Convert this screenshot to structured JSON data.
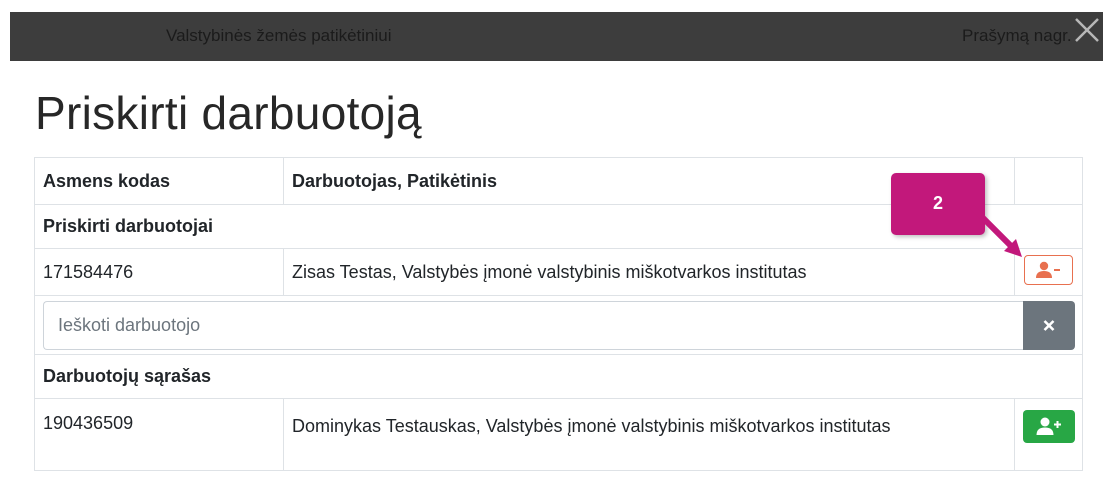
{
  "header": {
    "left_text": "Valstybinės žemės patikėtiniui",
    "right_text": "Prašymą nagr."
  },
  "title": "Priskirti darbuotoją",
  "table": {
    "col_code": "Asmens kodas",
    "col_worker": "Darbuotojas, Patikėtinis",
    "assigned_section": "Priskirti darbuotojai",
    "assigned_rows": [
      {
        "code": "171584476",
        "name": "Zisas Testas, Valstybės įmonė valstybinis miškotvarkos institutas"
      }
    ],
    "search": {
      "placeholder": "Ieškoti darbuotojo",
      "value": ""
    },
    "list_section": "Darbuotojų sąrašas",
    "list_rows": [
      {
        "code": "190436509",
        "name": "Dominykas Testauskas, Valstybės įmonė valstybinis miškotvarkos institutas"
      }
    ]
  },
  "annotation": {
    "number": "2",
    "color": "#c2187b"
  },
  "colors": {
    "remove_button": "#e8704f",
    "add_button": "#28a745",
    "clear_button": "#6c757d",
    "topbar": "#3d3d3d"
  },
  "icons": {
    "close": "close-icon",
    "remove_user": "user-minus-icon",
    "add_user": "user-plus-icon",
    "clear": "times-icon"
  }
}
